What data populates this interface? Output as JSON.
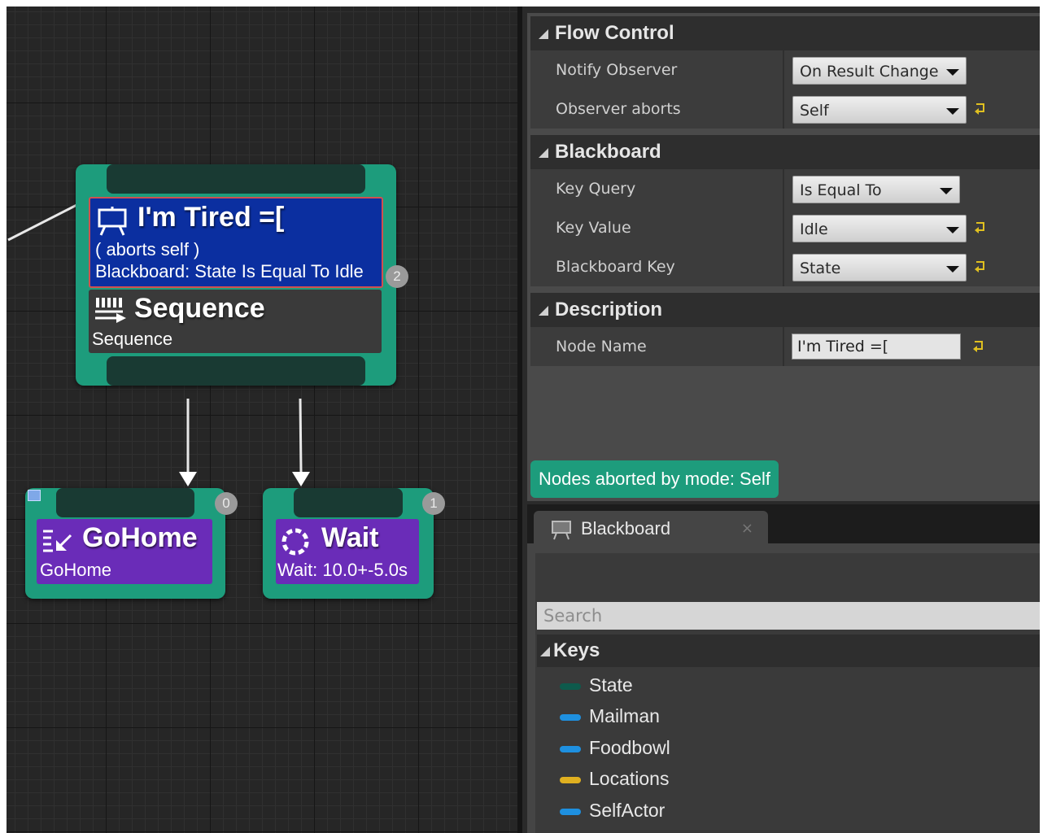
{
  "graph": {
    "root": {
      "decorator_title": "I'm Tired =[",
      "decorator_aborts": "( aborts self )",
      "decorator_desc": "Blackboard: State Is Equal To Idle",
      "decorator_index": "2",
      "composite_title": "Sequence",
      "composite_sub": "Sequence",
      "icons": [
        "blackboard-decorator-icon",
        "sequence-icon"
      ]
    },
    "children": [
      {
        "title": "GoHome",
        "sub": "GoHome",
        "index": "0",
        "icon": "task-move-icon"
      },
      {
        "title": "Wait",
        "sub": "Wait: 10.0+-5.0s",
        "index": "1",
        "icon": "wait-icon"
      }
    ]
  },
  "details": {
    "flow_control": {
      "header": "Flow Control",
      "notify_observer_label": "Notify Observer",
      "notify_observer_value": "On Result Change",
      "observer_aborts_label": "Observer aborts",
      "observer_aborts_value": "Self"
    },
    "blackboard": {
      "header": "Blackboard",
      "key_query_label": "Key Query",
      "key_query_value": "Is Equal To",
      "key_value_label": "Key Value",
      "key_value_value": "Idle",
      "bb_key_label": "Blackboard Key",
      "bb_key_value": "State"
    },
    "description": {
      "header": "Description",
      "node_name_label": "Node Name",
      "node_name_value": "I'm Tired =["
    },
    "aborted_note": "Nodes aborted by mode: Self",
    "colors": {
      "node_green": "#1d9c7c",
      "decorator_blue": "#0b2fa0",
      "task_purple": "#6a2cb8",
      "reset_arrow": "#e0c020"
    }
  },
  "blackboard_panel": {
    "tab_label": "Blackboard",
    "tab_close": "×",
    "search_placeholder": "Search",
    "keys_header": "Keys",
    "keys": [
      {
        "name": "State",
        "color": "#0e5a4c"
      },
      {
        "name": "Mailman",
        "color": "#1e90e0"
      },
      {
        "name": "Foodbowl",
        "color": "#1e90e0"
      },
      {
        "name": "Locations",
        "color": "#e0b020"
      },
      {
        "name": "SelfActor",
        "color": "#1e90e0"
      }
    ]
  }
}
